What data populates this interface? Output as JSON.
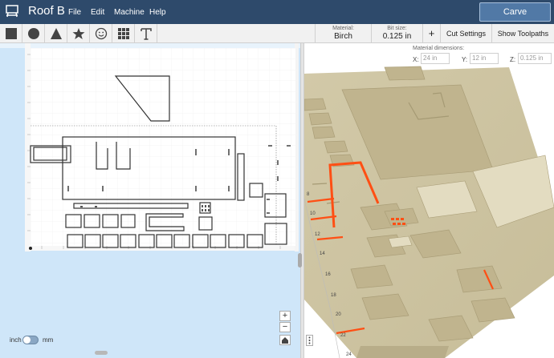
{
  "app": {
    "project_title": "Roof B",
    "logo_icon": "x-carve-machine-icon"
  },
  "menu": {
    "file": "File",
    "edit": "Edit",
    "machine": "Machine",
    "help": "Help"
  },
  "carve_button": "Carve",
  "tools": [
    "square-icon",
    "circle-icon",
    "triangle-icon",
    "star-icon",
    "smiley-icon",
    "icon-grid-icon",
    "text-icon"
  ],
  "material": {
    "label": "Material:",
    "value": "Birch"
  },
  "bit": {
    "label": "Bit size:",
    "value": "0.125 in"
  },
  "add_bit_label": "+",
  "cut_settings_label": "Cut Settings",
  "show_toolpaths_label": "Show Toolpaths",
  "dimensions": {
    "label": "Material dimensions:",
    "x_label": "X:",
    "x_value": "24 in",
    "y_label": "Y:",
    "y_value": "12 in",
    "z_label": "Z:",
    "z_value": "0.125 in"
  },
  "zoom": {
    "in": "+",
    "out": "−"
  },
  "units": {
    "inch": "inch",
    "mm": "mm"
  },
  "colors": {
    "topbar": "#2e4a6b",
    "carve_button": "#5179a6",
    "canvas_bg": "#cfe6f9",
    "wood": "#cdc3a2",
    "highlight": "#ff4f14"
  }
}
